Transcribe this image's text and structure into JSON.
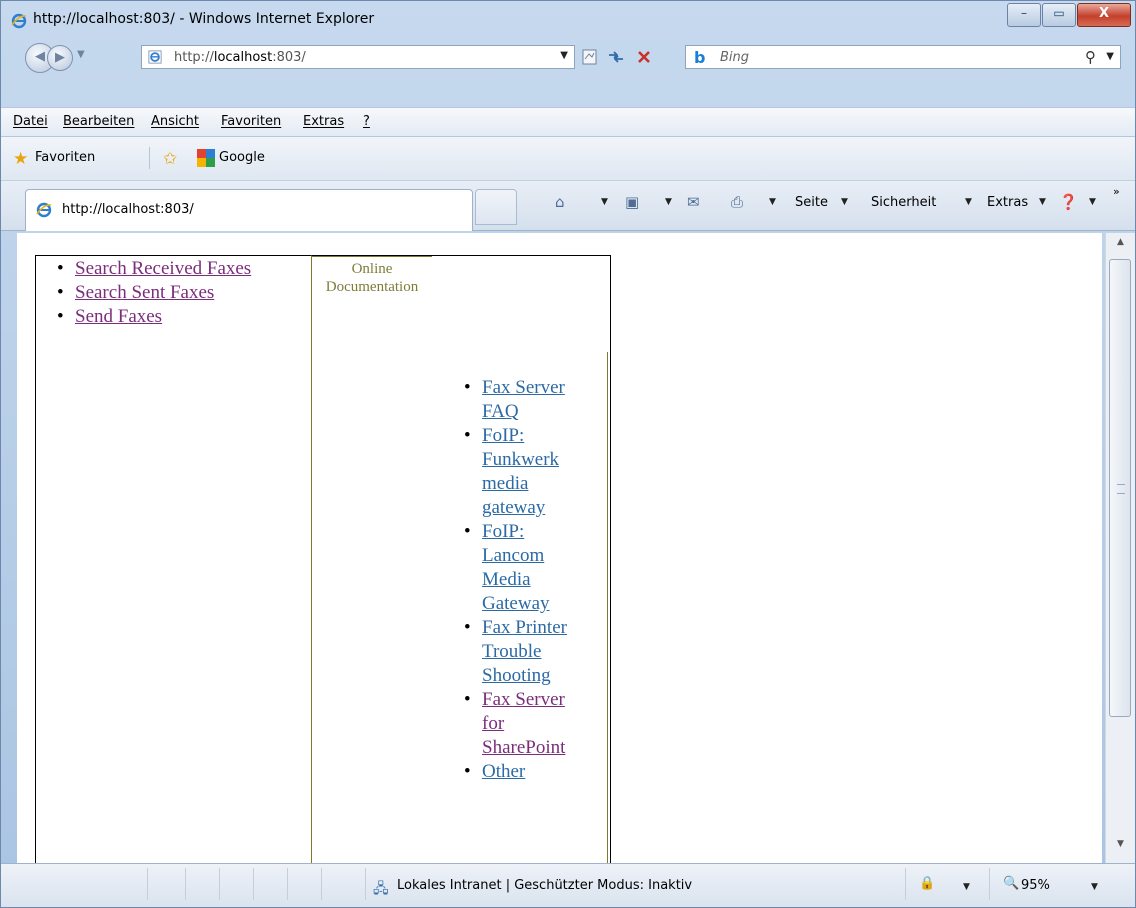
{
  "window": {
    "title": "http://localhost:803/ - Windows Internet Explorer",
    "minimize_glyph": "–",
    "maximize_glyph": "▭",
    "close_glyph": "X"
  },
  "address_bar": {
    "url_prefix": "http://",
    "url_host": "localhost",
    "url_suffix": ":803/"
  },
  "search": {
    "provider_logo": "b",
    "provider": "Bing"
  },
  "menu": {
    "items": [
      "Datei",
      "Bearbeiten",
      "Ansicht",
      "Favoriten",
      "Extras",
      "?"
    ]
  },
  "favorites_bar": {
    "favorites_label": "Favoriten",
    "google_label": "Google"
  },
  "tab": {
    "title": "http://localhost:803/"
  },
  "command_bar": {
    "page_label": "Seite",
    "safety_label": "Sicherheit",
    "tools_label": "Extras",
    "more_glyph": "»"
  },
  "page": {
    "left_links": [
      {
        "label": "Search Received Faxes",
        "visited": true
      },
      {
        "label": "Search Sent Faxes",
        "visited": true
      },
      {
        "label": "Send Faxes",
        "visited": true
      }
    ],
    "doc_heading_line1": "Online",
    "doc_heading_line2": "Documentation",
    "doc_links": [
      {
        "lines": [
          "Fax Server",
          "FAQ"
        ],
        "visited": false
      },
      {
        "lines": [
          "FoIP:",
          "Funkwerk",
          "media",
          "gateway"
        ],
        "visited": false
      },
      {
        "lines": [
          "FoIP:",
          "Lancom",
          "Media",
          "Gateway"
        ],
        "visited": false
      },
      {
        "lines": [
          "Fax Printer",
          "Trouble",
          "Shooting"
        ],
        "visited": false
      },
      {
        "lines": [
          "Fax Server",
          "for",
          "SharePoint"
        ],
        "visited": true
      },
      {
        "lines": [
          "Other"
        ],
        "visited": false
      }
    ]
  },
  "status_bar": {
    "zone_text": "Lokales Intranet | Geschützter Modus: Inaktiv",
    "zoom": "95%"
  },
  "colors": {
    "link": "#2b6aa5",
    "visited_link": "#7a2d7a",
    "doc_heading": "#7d7d3a"
  }
}
